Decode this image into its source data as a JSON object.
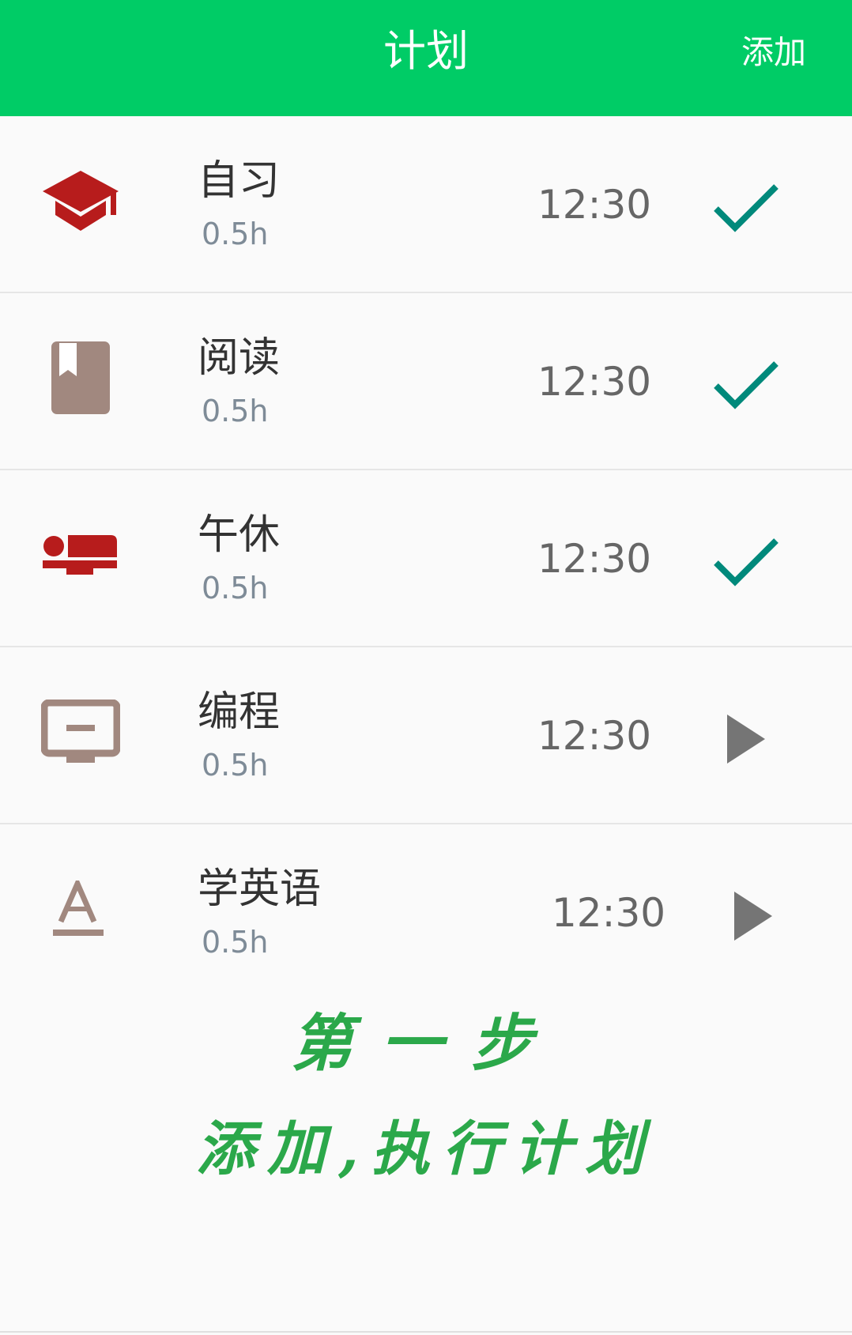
{
  "appbar": {
    "title": "计划",
    "action_label": "添加",
    "color": "#00cc66"
  },
  "plans": [
    {
      "title": "自习",
      "duration": "0.5h",
      "time": "12:30",
      "icon": "graduation-cap-icon",
      "icon_color": "#b71c1c",
      "status": "done"
    },
    {
      "title": "阅读",
      "duration": "0.5h",
      "time": "12:30",
      "icon": "book-icon",
      "icon_color": "#a1887f",
      "status": "done"
    },
    {
      "title": "午休",
      "duration": "0.5h",
      "time": "12:30",
      "icon": "bed-icon",
      "icon_color": "#b71c1c",
      "status": "done"
    },
    {
      "title": "编程",
      "duration": "0.5h",
      "time": "12:30",
      "icon": "monitor-icon",
      "icon_color": "#a1887f",
      "status": "play"
    },
    {
      "title": "学英语",
      "duration": "0.5h",
      "time": "12:30",
      "icon": "text-format-icon",
      "icon_color": "#a1887f",
      "status": "play"
    }
  ],
  "caption": {
    "line1": "第一步",
    "line2": "添加,执行计划",
    "color": "#2ba84a"
  },
  "colors": {
    "check": "#00897b",
    "play": "#757575"
  }
}
